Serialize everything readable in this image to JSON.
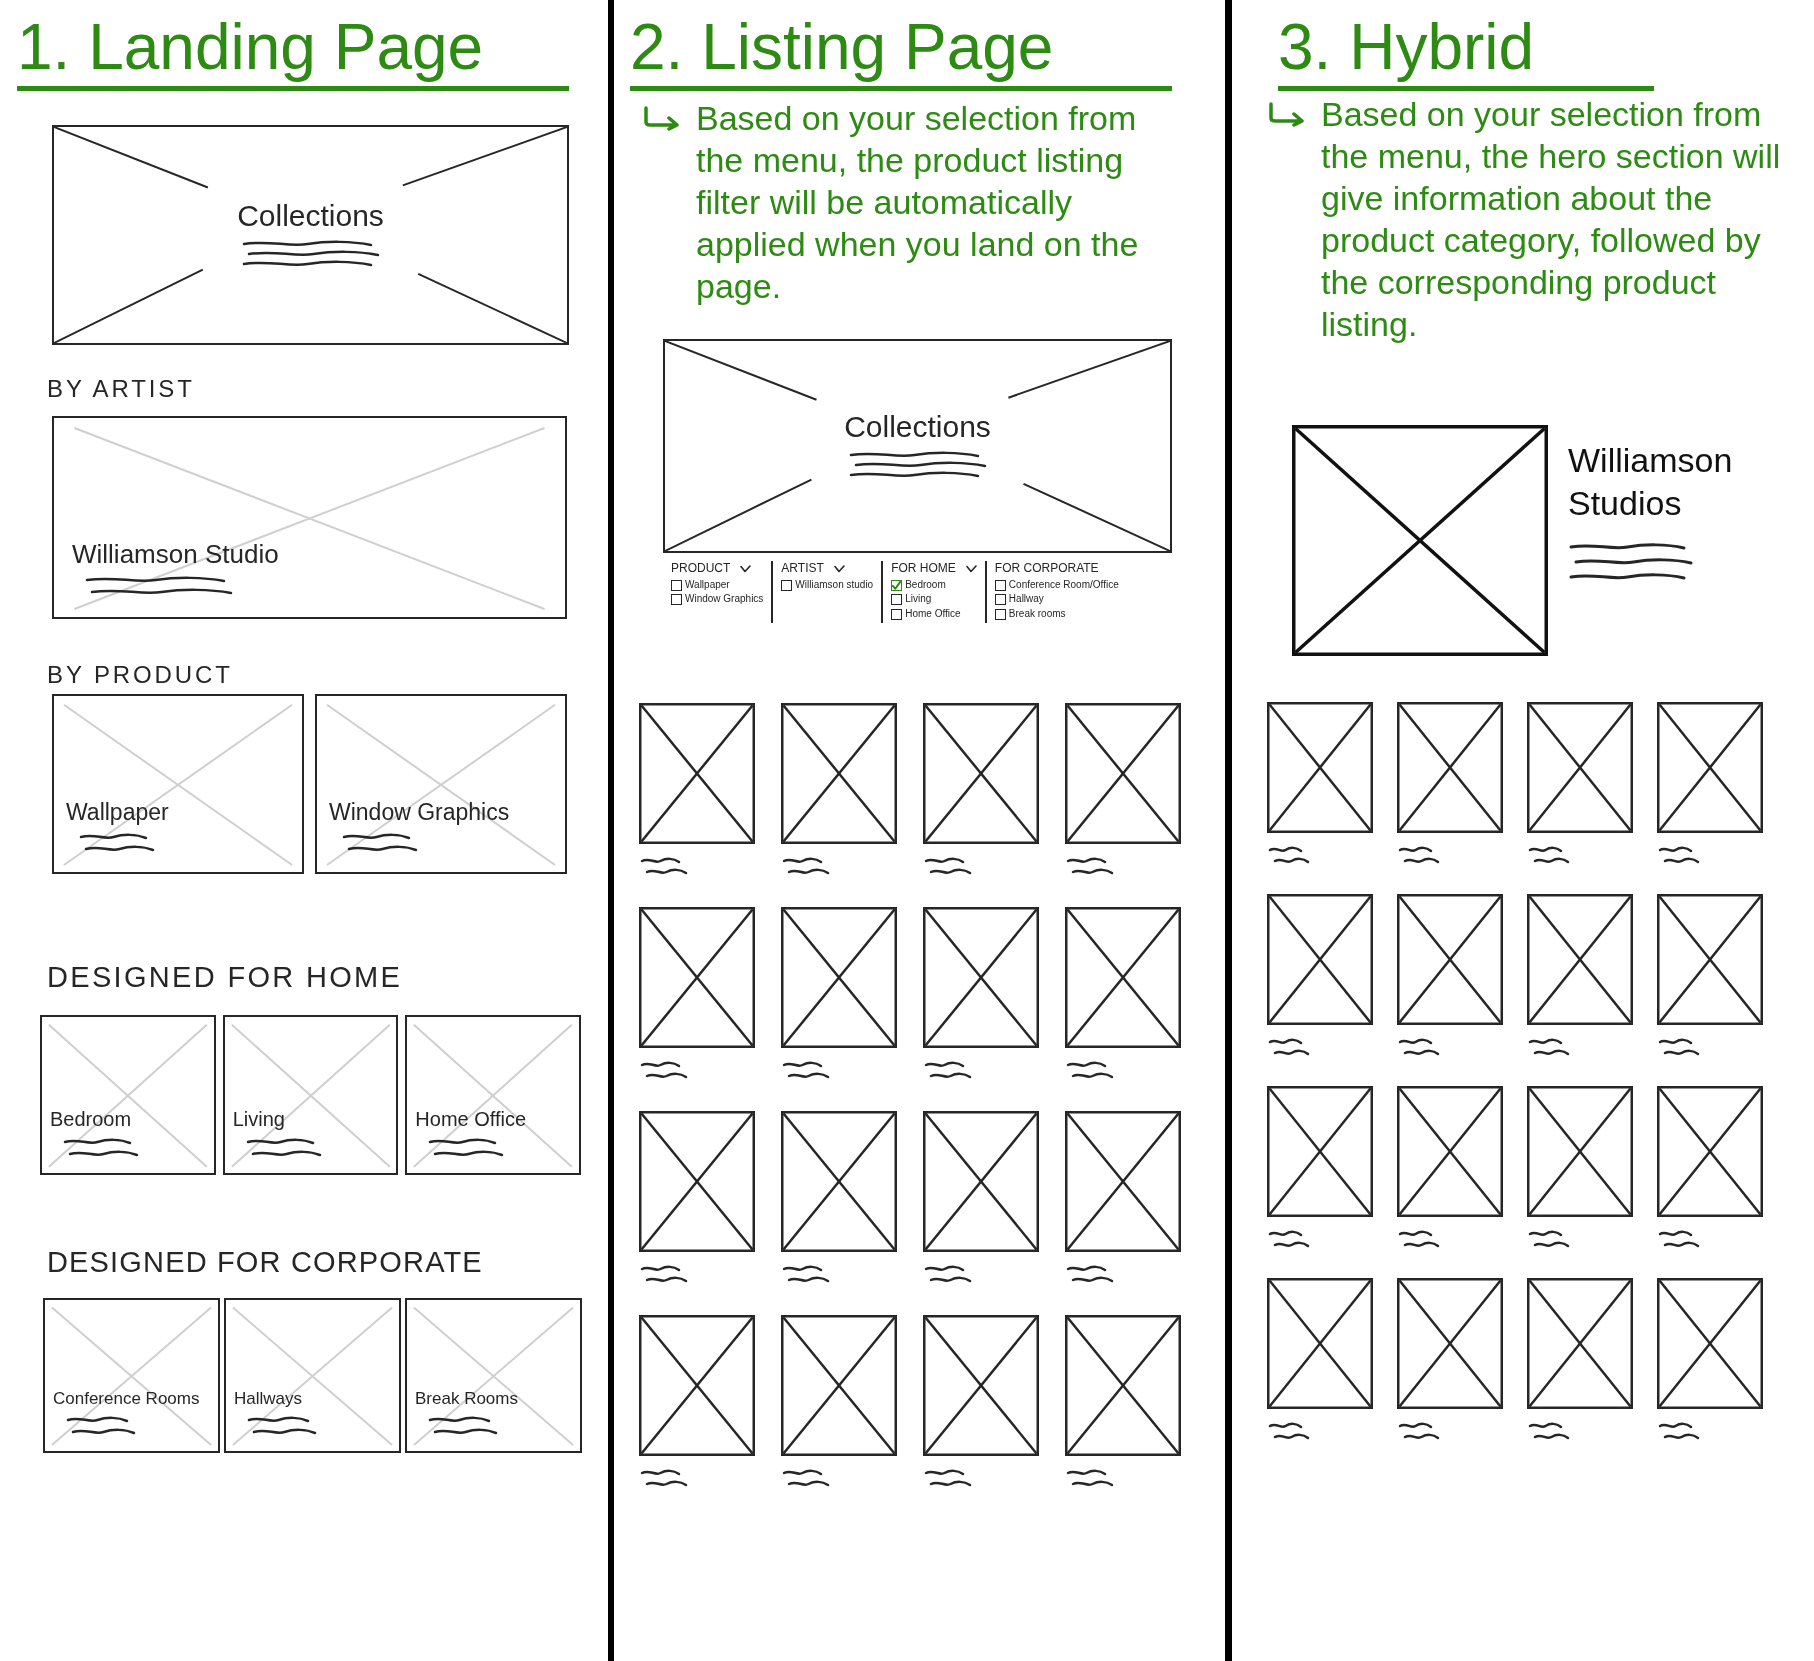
{
  "landing_page": {
    "title": "1. Landing Page",
    "hero": {
      "label": "Collections"
    },
    "sections": [
      {
        "heading": "BY ARTIST",
        "cards": [
          {
            "label": "Williamson Studio"
          }
        ]
      },
      {
        "heading": "BY PRODUCT",
        "cards": [
          {
            "label": "Wallpaper"
          },
          {
            "label": "Window Graphics"
          }
        ]
      },
      {
        "heading": "DESIGNED FOR HOME",
        "cards": [
          {
            "label": "Bedroom"
          },
          {
            "label": "Living"
          },
          {
            "label": "Home Office"
          }
        ]
      },
      {
        "heading": "DESIGNED FOR CORPORATE",
        "cards": [
          {
            "label": "Conference Rooms"
          },
          {
            "label": "Hallways"
          },
          {
            "label": "Break Rooms"
          }
        ]
      }
    ]
  },
  "listing_page": {
    "title": "2. Listing Page",
    "note": "Based on your selection from the menu, the product listing filter will be automatically applied when you land on the page.",
    "hero": {
      "label": "Collections"
    },
    "filters": [
      {
        "heading": "PRODUCT",
        "dropdown": true,
        "options": [
          {
            "label": "Wallpaper",
            "checked": false
          },
          {
            "label": "Window Graphics",
            "checked": false
          }
        ]
      },
      {
        "heading": "ARTIST",
        "dropdown": true,
        "options": [
          {
            "label": "Williamson studio",
            "checked": false
          }
        ]
      },
      {
        "heading": "FOR HOME",
        "dropdown": true,
        "options": [
          {
            "label": "Bedroom",
            "checked": true
          },
          {
            "label": "Living",
            "checked": false
          },
          {
            "label": "Home Office",
            "checked": false
          }
        ]
      },
      {
        "heading": "FOR CORPORATE",
        "dropdown": false,
        "options": [
          {
            "label": "Conference Room/Office",
            "checked": false
          },
          {
            "label": "Hallway",
            "checked": false
          },
          {
            "label": "Break rooms",
            "checked": false
          }
        ]
      }
    ]
  },
  "hybrid": {
    "title": "3. Hybrid",
    "note": "Based on your selection from the menu, the hero section will give information about the product category, followed by the corresponding product listing.",
    "hero": {
      "title": "Williamson Studios"
    }
  }
}
